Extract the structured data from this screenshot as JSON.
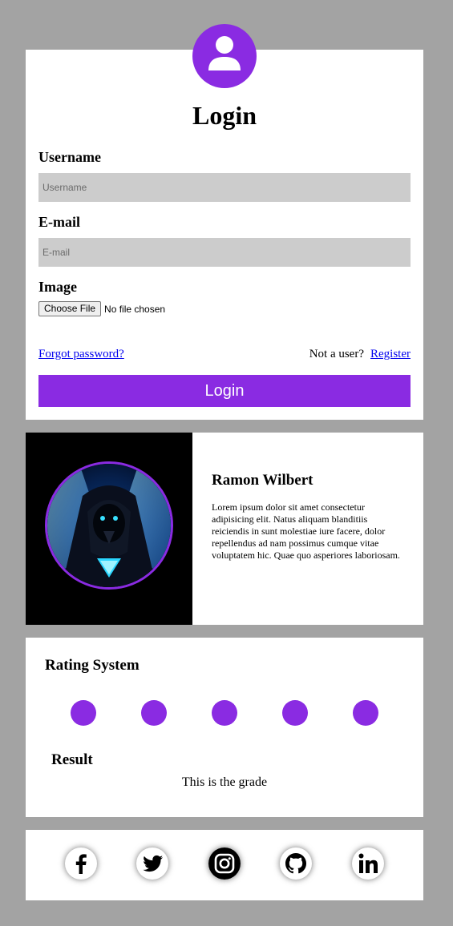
{
  "login": {
    "title": "Login",
    "username_label": "Username",
    "username_placeholder": "Username",
    "email_label": "E-mail",
    "email_placeholder": "E-mail",
    "image_label": "Image",
    "file_button": "Choose File",
    "file_status": "No file chosen",
    "forgot_link": "Forgot password?",
    "not_user_text": "Not a user?",
    "register_link": "Register",
    "submit_label": "Login"
  },
  "profile": {
    "name": "Ramon Wilbert",
    "description": "Lorem ipsum dolor sit amet consectetur adipisicing elit. Natus aliquam blanditiis reiciendis in sunt molestiae iure facere, dolor repellendus ad nam possimus cumque vitae voluptatem hic. Quae quo asperiores laboriosam."
  },
  "rating": {
    "title": "Rating System",
    "dots": 5,
    "result_label": "Result",
    "grade_text": "This is the grade"
  },
  "social": [
    "facebook-icon",
    "twitter-icon",
    "instagram-icon",
    "github-icon",
    "linkedin-icon"
  ],
  "colors": {
    "accent": "#8a2be2",
    "background": "#a3a3a3",
    "field": "#cccccc"
  }
}
